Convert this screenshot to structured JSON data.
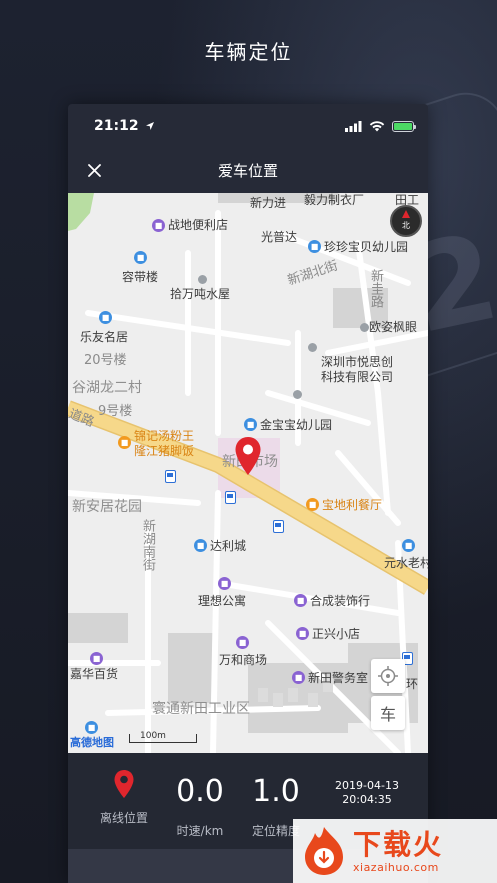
{
  "page": {
    "title": "车辆定位"
  },
  "status_bar": {
    "time": "21:12"
  },
  "nav": {
    "title": "爱车位置"
  },
  "map": {
    "labels": {
      "xinli_jin": "新力进",
      "yiwei": "毅力制衣厂",
      "tiangong": "田工",
      "zhandi": "战地便利店",
      "guangpu": "光普达",
      "zhenzhen": "珍珍宝贝幼儿园",
      "rongdai": "容带楼",
      "xinhu_north": "新湖北街",
      "shiwan": "拾万吨水屋",
      "xinzhu": "新圭路",
      "ouzi": "欧姿枫眼",
      "leyou": "乐友名居",
      "n20": "20号楼",
      "shenzhen_yuechuang": "深圳市悦思创",
      "keji": "科技有限公司",
      "guhu": "谷湖龙二村",
      "n9": "9号楼",
      "jinbaobao": "金宝宝幼儿园",
      "jinji": "锦记汤粉王",
      "longjiang": "隆江猪脚饭",
      "lu": "道路",
      "market": "新田市场",
      "baodi": "宝地利餐厅",
      "xinanju": "新安居花园",
      "xinhu_south": "新湖南街",
      "dali": "达利城",
      "yuanshui": "元水老村",
      "lixiang": "理想公寓",
      "hecheng": "合成装饰行",
      "zhengxing": "正兴小店",
      "wanhe": "万和商场",
      "jiahua": "嘉华百货",
      "xintian_police": "新田警务室",
      "huan": "环",
      "huantong": "寰通新田工业区",
      "scale": "100m",
      "logo": "高德地图"
    },
    "controls": {
      "compass_label": "北",
      "locate_icon": "crosshair-icon",
      "car_label": "车"
    }
  },
  "info": {
    "offline": {
      "label": "离线位置",
      "icon": "location-pin-icon"
    },
    "speed": {
      "value": "0.0",
      "label": "时速/km"
    },
    "accuracy": {
      "value": "1.0",
      "label": "定位精度"
    },
    "timestamp": {
      "date": "2019-04-13",
      "time": "20:04:35"
    }
  },
  "watermark": {
    "title": "下载火",
    "url": "xiazaihuo.com"
  },
  "colors": {
    "background": "#1b1f2b",
    "pin": "#e0262d",
    "watermark": "#e8481c",
    "road_main": "#f6d88a"
  }
}
